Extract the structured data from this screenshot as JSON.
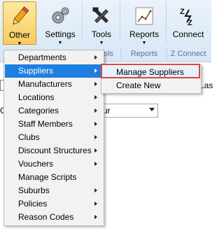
{
  "ribbon": {
    "buttons": [
      {
        "label": "Other",
        "icon": "pencil-icon"
      },
      {
        "label": "Settings",
        "icon": "gears-icon"
      },
      {
        "label": "Tools",
        "icon": "tools-icon"
      },
      {
        "label": "Reports",
        "icon": "chart-icon"
      },
      {
        "label": "Connect",
        "icon": "z-connect-icon"
      }
    ],
    "groups": [
      "ols",
      "Reports",
      "Z Connect"
    ]
  },
  "background": {
    "partial_text_right": "Las",
    "combo_partial_value": "ur",
    "left_partial": "G"
  },
  "menu": {
    "items": [
      {
        "label": "Departments",
        "has_submenu": true
      },
      {
        "label": "Suppliers",
        "has_submenu": true
      },
      {
        "label": "Manufacturers",
        "has_submenu": true
      },
      {
        "label": "Locations",
        "has_submenu": true
      },
      {
        "label": "Categories",
        "has_submenu": true
      },
      {
        "label": "Staff Members",
        "has_submenu": true
      },
      {
        "label": "Clubs",
        "has_submenu": true
      },
      {
        "label": "Discount Structures",
        "has_submenu": true
      },
      {
        "label": "Vouchers",
        "has_submenu": true
      },
      {
        "label": "Manage Scripts",
        "has_submenu": false
      },
      {
        "label": "Suburbs",
        "has_submenu": true
      },
      {
        "label": "Policies",
        "has_submenu": true
      },
      {
        "label": "Reason Codes",
        "has_submenu": true
      }
    ]
  },
  "submenu": {
    "items": [
      {
        "label": "Manage Suppliers"
      },
      {
        "label": "Create New"
      }
    ]
  },
  "colors": {
    "highlight": "#1e7fe0",
    "selection_outline": "#e04343",
    "active_button": "#f7cd5d"
  }
}
